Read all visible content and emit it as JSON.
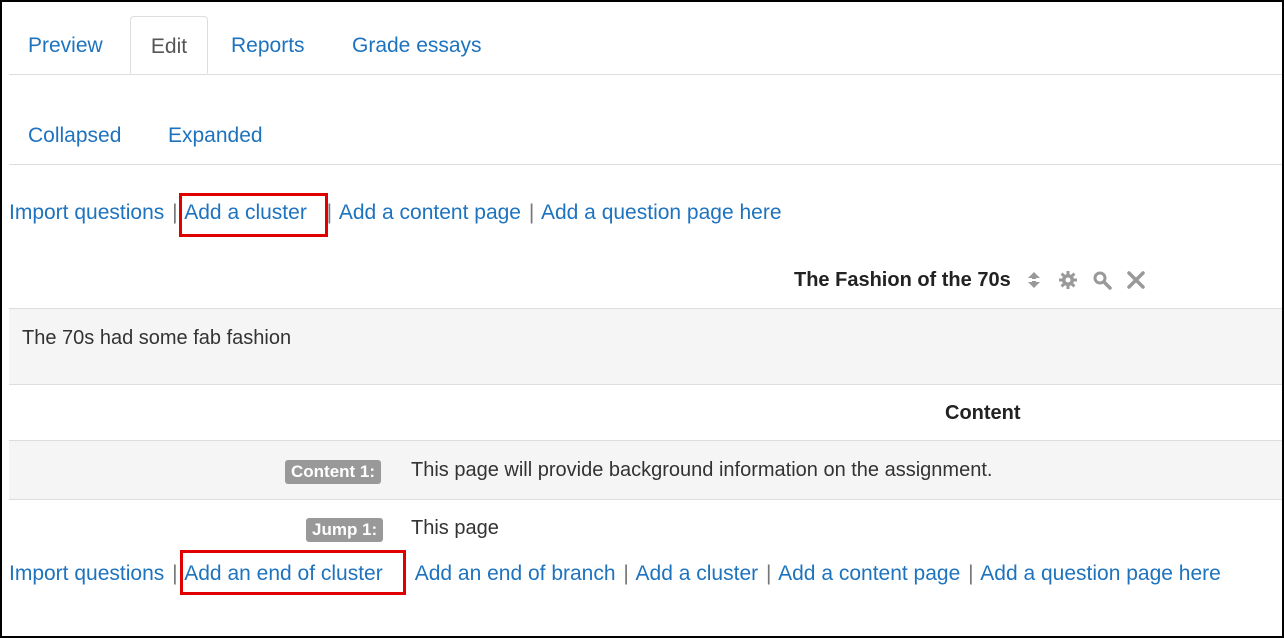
{
  "tabs": [
    {
      "label": "Preview",
      "active": false
    },
    {
      "label": "Edit",
      "active": true
    },
    {
      "label": "Reports",
      "active": false
    },
    {
      "label": "Grade essays",
      "active": false
    }
  ],
  "subtabs": [
    {
      "label": "Collapsed"
    },
    {
      "label": "Expanded"
    }
  ],
  "top_actions": {
    "import": "Import questions",
    "add_cluster": "Add a cluster",
    "add_content_page": "Add a content page",
    "add_question_page": "Add a question page here",
    "separator": "|"
  },
  "page": {
    "title": "The Fashion of the 70s",
    "description": "The 70s had some fab fashion",
    "column_header": "Content",
    "content_badge": "Content 1:",
    "content_text": "This page will provide background information on the assignment.",
    "jump_badge": "Jump 1:",
    "jump_text": "This page"
  },
  "bottom_actions": {
    "import": "Import questions",
    "add_end_cluster": "Add an end of cluster",
    "add_end_branch": "Add an end of branch",
    "add_cluster": "Add a cluster",
    "add_content_page": "Add a content page",
    "add_question_page": "Add a question page here",
    "separator": "|"
  },
  "colors": {
    "link": "#1e73be",
    "highlight": "#e00000",
    "badge": "#999999"
  }
}
